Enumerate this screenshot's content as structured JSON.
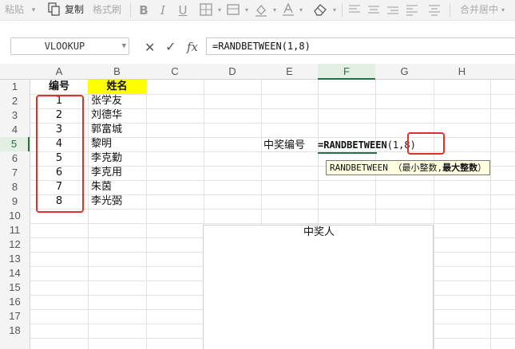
{
  "ribbon": {
    "paste": "粘贴",
    "copy": "复制",
    "format_painter": "格式刷",
    "merge_center": "合并居中"
  },
  "formula_bar": {
    "name_box": "VLOOKUP",
    "cancel": "✕",
    "accept": "✓",
    "insert_function": "fx",
    "formula": "=RANDBETWEEN(1,8)"
  },
  "columns": [
    "A",
    "B",
    "C",
    "D",
    "E",
    "F",
    "G",
    "H"
  ],
  "selected_column": "F",
  "rows": [
    "1",
    "2",
    "3",
    "4",
    "5",
    "6",
    "7",
    "8",
    "9",
    "10",
    "11",
    "12",
    "13",
    "14",
    "15",
    "16",
    "17",
    "18"
  ],
  "selected_row": "5",
  "table": {
    "header_id": "编号",
    "header_name": "姓名",
    "ids": [
      "1",
      "2",
      "3",
      "4",
      "5",
      "6",
      "7",
      "8"
    ],
    "names": [
      "张学友",
      "刘德华",
      "郭富城",
      "黎明",
      "李克勤",
      "李克用",
      "朱茵",
      "李光弼"
    ]
  },
  "draw": {
    "label_winner_id": "中奖编号",
    "edit_func": "=RANDBETWEEN",
    "edit_args": "(1,8)",
    "tooltip_func": "RANDBETWEEN",
    "tooltip_arg1": "（最小整数,",
    "tooltip_arg2": "最大整数",
    "tooltip_close": "）",
    "winner_label": "中奖人"
  },
  "colors": {
    "highlight_border": "#e0302a",
    "header_fill": "#ffff00",
    "selection": "#217346",
    "tooltip_bg": "#ffffe1"
  }
}
